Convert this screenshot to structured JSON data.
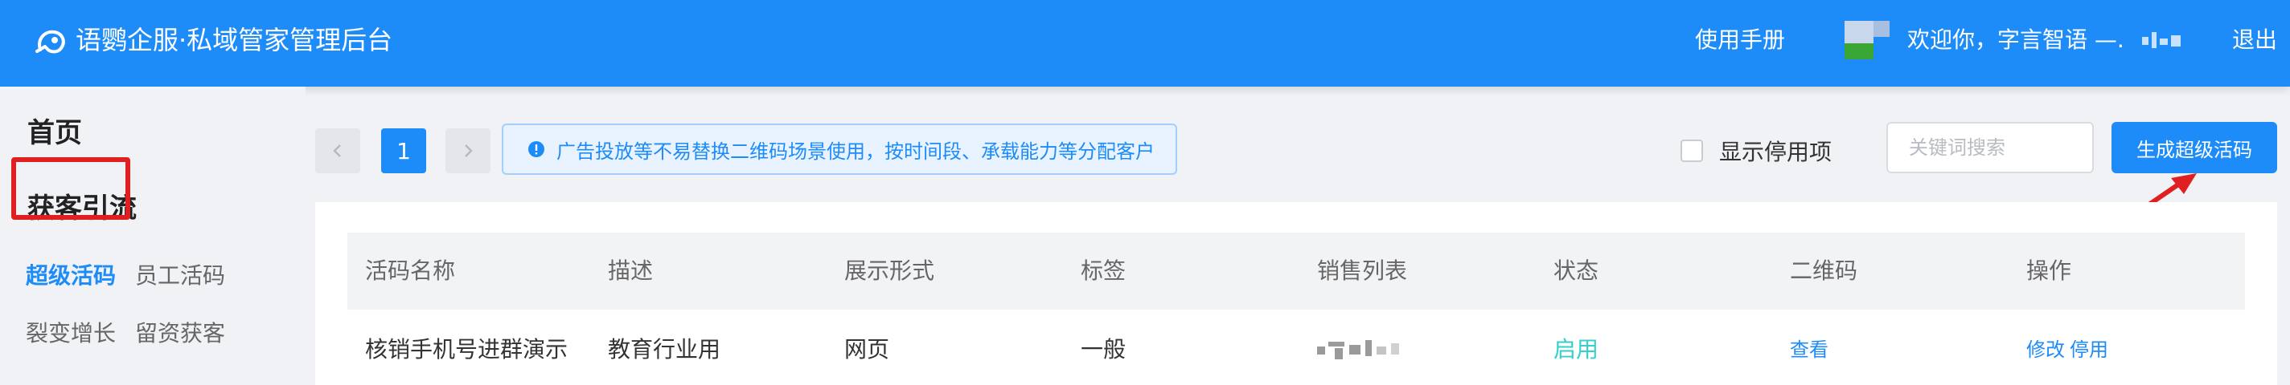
{
  "header": {
    "title": "语鹦企服·私域管家管理后台",
    "manual_label": "使用手册",
    "welcome_text": "欢迎你，字言智语 —.",
    "logout_label": "退出",
    "bg_color": "#1d8cf8"
  },
  "sidebar": {
    "home_label": "首页",
    "group_label": "获客引流",
    "items": [
      {
        "label": "超级活码",
        "active": true
      },
      {
        "label": "员工活码",
        "active": false
      },
      {
        "label": "裂变增长",
        "active": false
      },
      {
        "label": "留资获客",
        "active": false
      }
    ]
  },
  "toolbar": {
    "current_page": "1",
    "notice_text": "广告投放等不易替换二维码场景使用，按时间段、承载能力等分配客户",
    "show_disabled_label": "显示停用项",
    "show_disabled_checked": false,
    "search_placeholder": "关键词搜索",
    "create_button_label": "生成超级活码"
  },
  "table": {
    "columns": [
      "活码名称",
      "描述",
      "展示形式",
      "标签",
      "销售列表",
      "状态",
      "二维码",
      "操作"
    ],
    "rows": [
      {
        "name": "核销手机号进群演示",
        "description": "教育行业用",
        "display": "网页",
        "tag": "一般",
        "sales": "",
        "status": "启用",
        "qrcode": "查看",
        "action_edit": "修改",
        "action_disable": "停用"
      }
    ]
  },
  "colors": {
    "accent": "#1d8cf8",
    "status_enabled": "#36cfc9",
    "annotation_red": "#e02020"
  },
  "icons": {
    "logo": "parrot-logo-icon",
    "notice": "info-circle-icon",
    "prev": "chevron-left-icon",
    "next": "chevron-right-icon"
  }
}
